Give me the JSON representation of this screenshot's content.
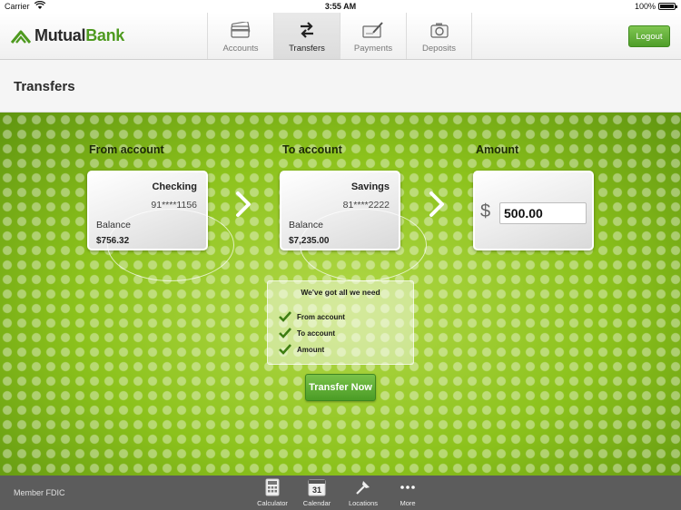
{
  "status": {
    "carrier": "Carrier",
    "time": "3:55 AM",
    "battery": "100%"
  },
  "brand": {
    "part1": "Mutual",
    "part2": "Bank"
  },
  "tabs": [
    {
      "label": "Accounts",
      "icon": "credit-card-icon"
    },
    {
      "label": "Transfers",
      "icon": "transfer-arrows-icon"
    },
    {
      "label": "Payments",
      "icon": "pen-check-icon"
    },
    {
      "label": "Deposits",
      "icon": "camera-icon"
    }
  ],
  "logout_label": "Logout",
  "page_title": "Transfers",
  "transfer": {
    "from_label": "From account",
    "to_label": "To account",
    "amount_label": "Amount",
    "from": {
      "name": "Checking",
      "number": "91****1156",
      "balance_label": "Balance",
      "balance": "$756.32"
    },
    "to": {
      "name": "Savings",
      "number": "81****2222",
      "balance_label": "Balance",
      "balance": "$7,235.00"
    },
    "currency_symbol": "$",
    "amount": "500.00"
  },
  "checklist": {
    "heading": "We've got all we need",
    "items": [
      "From account",
      "To account",
      "Amount"
    ]
  },
  "transfer_button": "Transfer Now",
  "footer": {
    "fdic": "Member FDIC",
    "calendar_day": "31",
    "tools": [
      {
        "label": "Calculator",
        "icon": "calculator-icon"
      },
      {
        "label": "Calendar",
        "icon": "calendar-icon"
      },
      {
        "label": "Locations",
        "icon": "map-pin-icon"
      },
      {
        "label": "More",
        "icon": "more-dots-icon"
      }
    ]
  },
  "colors": {
    "accent": "#4e9a1f",
    "button_green": "#5aa82f",
    "content_green": "#8fc61d"
  }
}
